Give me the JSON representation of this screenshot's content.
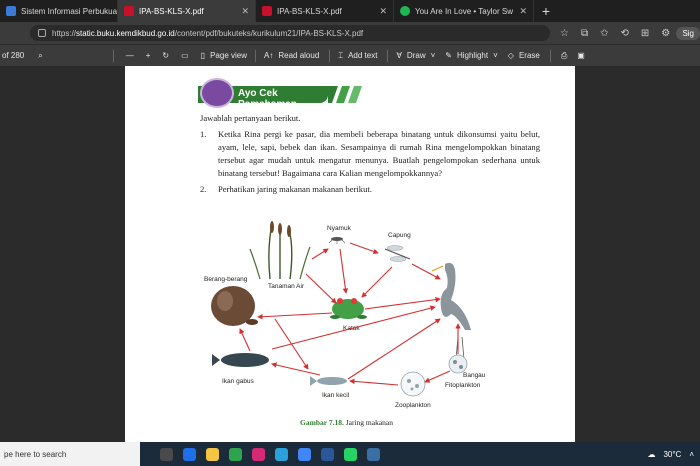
{
  "tabs": [
    {
      "title": "Sistem Informasi Perbukua",
      "color": "#3a7bd5",
      "active": false
    },
    {
      "title": "IPA-BS-KLS-X.pdf",
      "color": "#c8102e",
      "active": true
    },
    {
      "title": "IPA-BS-KLS-X.pdf",
      "color": "#c8102e",
      "active": false
    },
    {
      "title": "You Are In Love • Taylor Sw",
      "color": "#1db954",
      "active": false
    }
  ],
  "address": {
    "protocol": "https://",
    "host": "static.buku.kemdikbud.go.id",
    "path": "/content/pdf/bukuteks/kurikulum21/IPA-BS-KLS-X.pdf"
  },
  "account_label": "Sig",
  "pdf_toolbar": {
    "page_count": "of 280",
    "page_view": "Page view",
    "read_aloud": "Read aloud",
    "add_text": "Add text",
    "draw": "Draw",
    "highlight": "Highlight",
    "erase": "Erase"
  },
  "document": {
    "section_title": "Ayo Cek Pemahaman",
    "instruction": "Jawablah pertanyaan berikut.",
    "questions": [
      {
        "num": "1.",
        "text": "Ketika Rina pergi ke pasar, dia membeli beberapa binatang untuk dikonsumsi yaitu belut, ayam, lele, sapi, bebek dan ikan. Sesampainya di rumah Rina mengelompokkan binatang tersebut agar mudah untuk mengatur menunya. Buatlah pengelompokan sederhana untuk binatang tersebut! Bagaimana cara Kalian mengelompokkannya?"
      },
      {
        "num": "2.",
        "text": "Perhatikan jaring makanan makanan berikut."
      }
    ],
    "diagram_labels": {
      "nyamuk": "Nyamuk",
      "capung": "Capung",
      "tanaman": "Tanaman Air",
      "berang": "Berang-berang",
      "katak": "Katak",
      "bangau": "Bangau",
      "gabus": "Ikan gabus",
      "fitoplankton": "Fitoplankton",
      "zooplankton": "Zooplankton",
      "kecil": "Ikan kecil"
    },
    "caption_label": "Gambar 7.18.",
    "caption_text": " Jaring makanan"
  },
  "taskbar": {
    "search_placeholder": "pe here to search",
    "temperature": "30°C"
  }
}
